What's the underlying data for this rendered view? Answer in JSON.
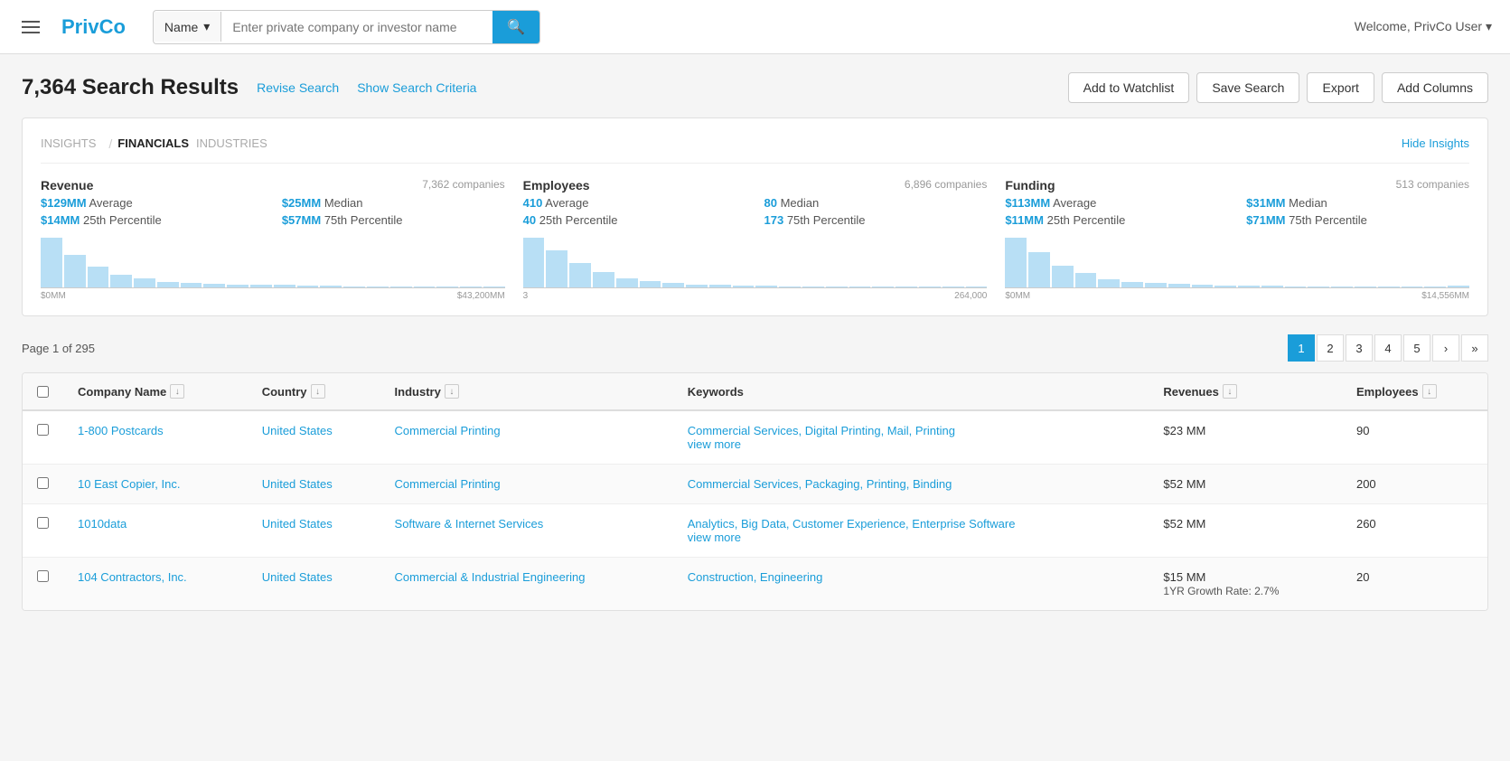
{
  "header": {
    "logo": "PrivCo",
    "search_type": "Name",
    "search_placeholder": "Enter private company or investor name",
    "welcome_text": "Welcome, PrivCo User"
  },
  "toolbar": {
    "results_count": "7,364 Search Results",
    "revise_search": "Revise Search",
    "show_criteria": "Show Search Criteria",
    "add_watchlist": "Add to Watchlist",
    "save_search": "Save Search",
    "export": "Export",
    "add_columns": "Add Columns"
  },
  "insights": {
    "tab_insights": "INSIGHTS",
    "tab_financials": "FINANCIALS",
    "tab_industries": "INDUSTRIES",
    "hide_label": "Hide Insights",
    "revenue": {
      "title": "Revenue",
      "count": "7,362 companies",
      "avg_label": "Average",
      "avg_value": "$129MM",
      "median_label": "Median",
      "median_value": "$25MM",
      "p25_label": "25th Percentile",
      "p25_value": "$14MM",
      "p75_label": "75th Percentile",
      "p75_value": "$57MM",
      "x_min": "$0MM",
      "x_max": "$43,200MM",
      "bars": [
        85,
        55,
        35,
        22,
        15,
        10,
        8,
        6,
        5,
        4,
        4,
        3,
        3,
        2,
        2,
        2,
        1,
        1,
        1,
        1
      ]
    },
    "employees": {
      "title": "Employees",
      "count": "6,896 companies",
      "avg_label": "Average",
      "avg_value": "410",
      "median_label": "Median",
      "median_value": "80",
      "p25_label": "25th Percentile",
      "p25_value": "40",
      "p75_label": "75th Percentile",
      "p75_value": "173",
      "x_min": "3",
      "x_max": "264,000",
      "bars": [
        80,
        60,
        40,
        25,
        15,
        10,
        8,
        5,
        4,
        3,
        3,
        2,
        2,
        1,
        1,
        1,
        1,
        1,
        1,
        1
      ]
    },
    "funding": {
      "title": "Funding",
      "count": "513 companies",
      "avg_label": "Average",
      "avg_value": "$113MM",
      "median_label": "Median",
      "median_value": "$31MM",
      "p25_label": "25th Percentile",
      "p25_value": "$11MM",
      "p75_label": "75th Percentile",
      "p75_value": "$71MM",
      "x_min": "$0MM",
      "x_max": "$14,556MM",
      "bars": [
        70,
        50,
        30,
        20,
        12,
        8,
        6,
        5,
        4,
        3,
        2,
        2,
        1,
        1,
        1,
        1,
        1,
        1,
        1,
        2
      ]
    }
  },
  "pagination": {
    "page_info": "Page 1 of 295",
    "pages": [
      "1",
      "2",
      "3",
      "4",
      "5"
    ],
    "next": "›",
    "last": "»"
  },
  "table": {
    "columns": [
      {
        "label": "Company Name",
        "key": "company_name",
        "filterable": true
      },
      {
        "label": "Country",
        "key": "country",
        "filterable": true
      },
      {
        "label": "Industry",
        "key": "industry",
        "filterable": true
      },
      {
        "label": "Keywords",
        "key": "keywords",
        "filterable": false
      },
      {
        "label": "Revenues",
        "key": "revenues",
        "filterable": true
      },
      {
        "label": "Employees",
        "key": "employees",
        "filterable": true
      }
    ],
    "rows": [
      {
        "company": "1-800 Postcards",
        "country": "United States",
        "industry": "Commercial Printing",
        "keywords": "Commercial Services, Digital Printing, Mail, Printing",
        "keywords_extra": "view more",
        "revenue": "$23 MM",
        "employees": "90"
      },
      {
        "company": "10 East Copier, Inc.",
        "country": "United States",
        "industry": "Commercial Printing",
        "keywords": "Commercial Services, Packaging, Printing, Binding",
        "keywords_extra": "",
        "revenue": "$52 MM",
        "employees": "200"
      },
      {
        "company": "1010data",
        "country": "United States",
        "industry": "Software & Internet Services",
        "keywords": "Analytics, Big Data, Customer Experience, Enterprise Software",
        "keywords_extra": "view more",
        "revenue": "$52 MM",
        "employees": "260"
      },
      {
        "company": "104 Contractors, Inc.",
        "country": "United States",
        "industry": "Commercial & Industrial Engineering",
        "keywords": "Construction, Engineering",
        "keywords_extra": "",
        "revenue": "$15 MM\n1YR Growth Rate: 2.7%",
        "employees": "20"
      }
    ]
  }
}
